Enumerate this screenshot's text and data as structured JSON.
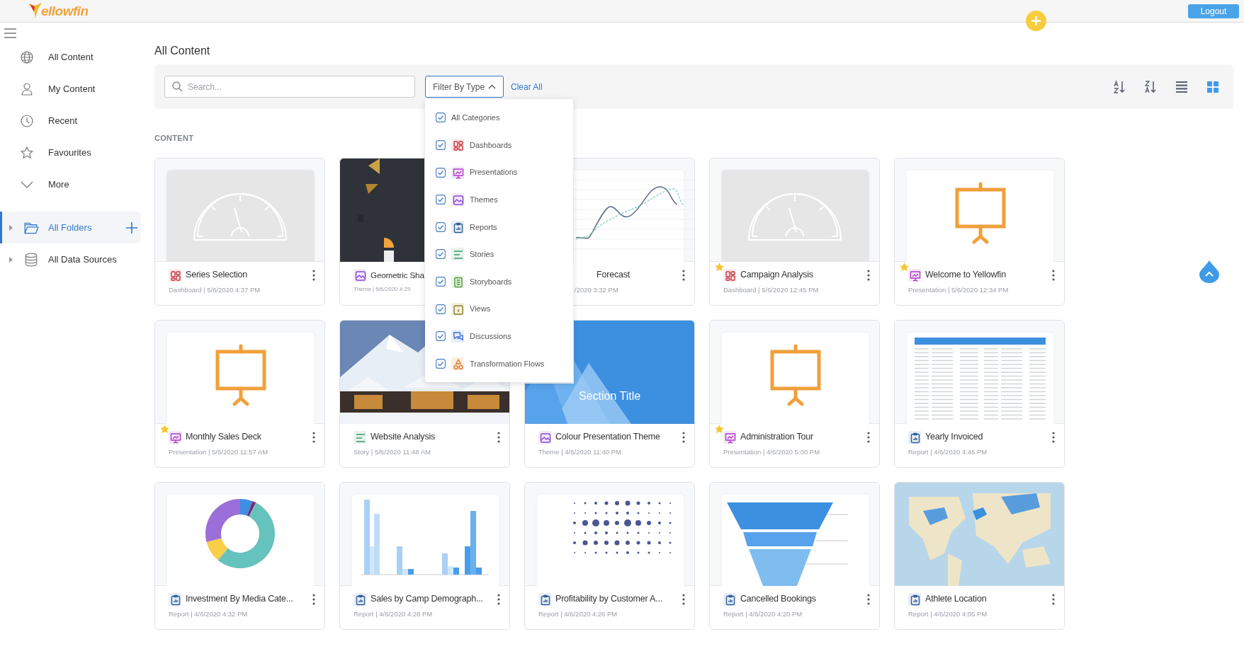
{
  "header": {
    "logo_text": "ellowfin",
    "logout": "Logout"
  },
  "sidebar": {
    "items": [
      {
        "label": "All Content",
        "kind": "globe"
      },
      {
        "label": "My Content",
        "kind": "person"
      },
      {
        "label": "Recent",
        "kind": "clock"
      },
      {
        "label": "Favourites",
        "kind": "star"
      },
      {
        "label": "More",
        "kind": "chevron"
      }
    ],
    "trees": [
      {
        "label": "All Folders",
        "kind": "folder",
        "selected": true,
        "expanded": false
      },
      {
        "label": "All Data Sources",
        "kind": "database",
        "selected": false,
        "expanded": false
      }
    ]
  },
  "page_title": "All Content",
  "toolbar": {
    "search": {
      "placeholder": "Search..."
    },
    "filter": {
      "label": "Filter By Type",
      "expanded": true
    },
    "clear": "Clear All",
    "view_buttons": [
      {
        "kind": "sort-az",
        "selected": false
      },
      {
        "kind": "sort-za",
        "selected": false
      },
      {
        "kind": "list",
        "selected": false
      },
      {
        "kind": "grid",
        "selected": true
      }
    ]
  },
  "filter_menu": [
    {
      "label": "All Categories",
      "checked": true
    },
    {
      "label": "Dashboards",
      "kind": "dashboard",
      "checked": true
    },
    {
      "label": "Presentations",
      "kind": "presentation",
      "checked": true
    },
    {
      "label": "Themes",
      "kind": "theme",
      "checked": true
    },
    {
      "label": "Reports",
      "kind": "report",
      "checked": true
    },
    {
      "label": "Stories",
      "kind": "story",
      "checked": true
    },
    {
      "label": "Storyboards",
      "kind": "storyboard",
      "checked": true
    },
    {
      "label": "Views",
      "kind": "view",
      "checked": true
    },
    {
      "label": "Discussions",
      "kind": "discussion",
      "checked": true
    },
    {
      "label": "Transformation Flows",
      "kind": "transformation",
      "checked": true
    }
  ],
  "section_label": "CONTENT",
  "cards": [
    {
      "title": "Series Selection",
      "meta": "Dashboard | 5/6/2020 4:37 PM",
      "kind": "dashboard",
      "thumbnail": {
        "kind": "gauge"
      },
      "favourite": false
    },
    {
      "title": "Geometric Sha",
      "meta": "Theme | 5/6/2020 4:25",
      "kind": "theme",
      "thumbnail": {
        "kind": "geometric"
      },
      "favourite": false
    },
    {
      "title": "Forecast",
      "meta": "/2020 3:32 PM",
      "thumbnail": {
        "kind": "line"
      }
    },
    {
      "title": "Campaign Analysis",
      "meta": "Dashboard | 5/6/2020 12:45 PM",
      "kind": "dashboard",
      "thumbnail": {
        "kind": "gauge"
      },
      "favourite": true
    },
    {
      "title": "Welcome to Yellowfin",
      "meta": "Presentation | 5/6/2020 12:34 PM",
      "kind": "presentation",
      "thumbnail": {
        "kind": "easel"
      },
      "favourite": true
    },
    {
      "title": "Monthly Sales Deck",
      "meta": "Presentation | 5/6/2020 11:57 AM",
      "kind": "presentation",
      "thumbnail": {
        "kind": "easel"
      },
      "favourite": true
    },
    {
      "title": "Website Analysis",
      "meta": "Story | 5/6/2020 11:48 AM",
      "kind": "story",
      "thumbnail": {
        "kind": "ski"
      },
      "favourite": false
    },
    {
      "title": "Colour Presentation Theme",
      "meta": "Theme | 4/6/2020 11:40 PM",
      "kind": "theme",
      "thumbnail": {
        "kind": "section",
        "text": "Section Title"
      },
      "favourite": false
    },
    {
      "title": "Administration Tour",
      "meta": "Presentation | 4/6/2020 5:00 PM",
      "kind": "presentation",
      "thumbnail": {
        "kind": "easel"
      },
      "favourite": true
    },
    {
      "title": "Yearly Invoiced",
      "meta": "Report | 4/6/2020 4:46 PM",
      "kind": "report",
      "thumbnail": {
        "kind": "table"
      },
      "favourite": false
    },
    {
      "title": "Investment By Media Cate...",
      "meta": "Report | 4/6/2020 4:32 PM",
      "kind": "report",
      "thumbnail": {
        "kind": "donut"
      },
      "favourite": false
    },
    {
      "title": "Sales by Camp Demograph...",
      "meta": "Report | 4/6/2020 4:28 PM",
      "kind": "report",
      "thumbnail": {
        "kind": "bars"
      },
      "favourite": false
    },
    {
      "title": "Profitability by Customer A...",
      "meta": "Report | 4/6/2020 4:26 PM",
      "kind": "report",
      "thumbnail": {
        "kind": "dots"
      },
      "favourite": false
    },
    {
      "title": "Cancelled Bookings",
      "meta": "Report | 4/6/2020 4:20 PM",
      "kind": "report",
      "thumbnail": {
        "kind": "funnel"
      },
      "favourite": false
    },
    {
      "title": "Athlete Location",
      "meta": "Report | 4/6/2020 4:05 PM",
      "kind": "report",
      "thumbnail": {
        "kind": "map"
      },
      "favourite": false
    }
  ]
}
